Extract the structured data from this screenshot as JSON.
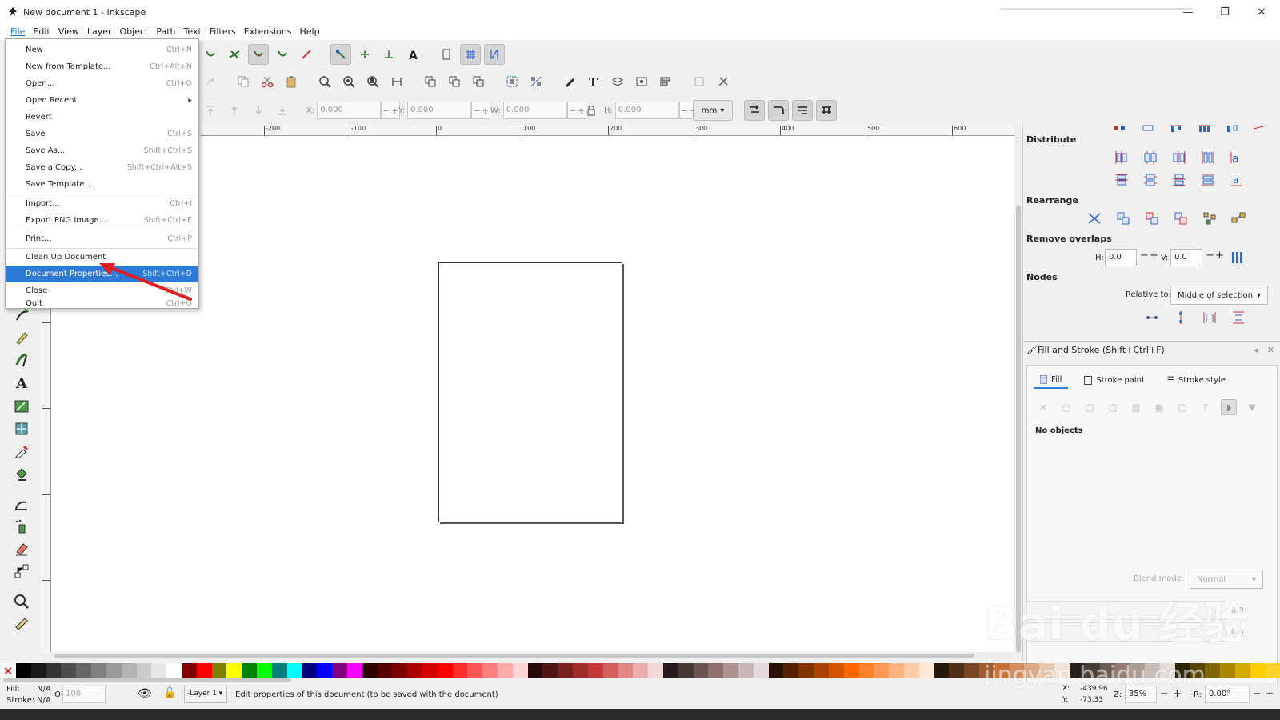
{
  "window": {
    "title": "New document 1 - Inkscape",
    "minimize": "—",
    "maximize": "❐",
    "close": "✕"
  },
  "menubar": [
    "File",
    "Edit",
    "View",
    "Layer",
    "Object",
    "Path",
    "Text",
    "Filters",
    "Extensions",
    "Help"
  ],
  "file_menu": [
    {
      "label": "New",
      "shortcut": "Ctrl+N"
    },
    {
      "label": "New from Template...",
      "shortcut": "Ctrl+Alt+N"
    },
    {
      "label": "Open...",
      "shortcut": "Ctrl+O"
    },
    {
      "label": "Open Recent",
      "shortcut": "▸"
    },
    {
      "label": "Revert",
      "shortcut": ""
    },
    {
      "label": "Save",
      "shortcut": "Ctrl+S"
    },
    {
      "label": "Save As...",
      "shortcut": "Shift+Ctrl+S"
    },
    {
      "label": "Save a Copy...",
      "shortcut": "Shift+Ctrl+Alt+S"
    },
    {
      "label": "Save Template...",
      "shortcut": ""
    },
    {
      "label": "Import...",
      "shortcut": "Ctrl+I"
    },
    {
      "label": "Export PNG Image...",
      "shortcut": "Shift+Ctrl+E"
    },
    {
      "label": "Print...",
      "shortcut": "Ctrl+P"
    },
    {
      "label": "Clean Up Document",
      "shortcut": ""
    },
    {
      "label": "Document Properties...",
      "shortcut": "Shift+Ctrl+D"
    },
    {
      "label": "Close",
      "shortcut": "Ctrl+W"
    },
    {
      "label": "Quit",
      "shortcut": "Ctrl+Q"
    }
  ],
  "toolcontrols": {
    "x_label": "X:",
    "x_value": "0.000",
    "y_label": "Y:",
    "y_value": "0.000",
    "w_label": "W:",
    "w_value": "0.000",
    "h_label": "H:",
    "h_value": "0.000",
    "units": "mm",
    "minus": "−",
    "plus": "+"
  },
  "ruler_labels": [
    "-200",
    "-100",
    "0",
    "100",
    "200",
    "300",
    "400",
    "500",
    "600"
  ],
  "right_panel": {
    "distribute": "Distribute",
    "rearrange": "Rearrange",
    "remove_overlaps": "Remove overlaps",
    "h_label": "H:",
    "h_value": "0.0",
    "v_label": "V:",
    "v_value": "0.0",
    "nodes": "Nodes",
    "relative_to_label": "Relative to:",
    "relative_to_value": "Middle of selection",
    "fill_stroke_title": "Fill and Stroke (Shift+Ctrl+F)",
    "tab_fill": "Fill",
    "tab_stroke_paint": "Stroke paint",
    "tab_stroke_style": "Stroke style",
    "no_objects": "No objects",
    "blend_mode_label": "Blend mode:",
    "blend_mode_value": "Normal",
    "blur_value": "0.0",
    "opacity_value": "0.0"
  },
  "status": {
    "fill_label": "Fill:",
    "fill_value": "N/A",
    "stroke_label": "Stroke:",
    "stroke_value": "N/A",
    "opacity_label": "O:",
    "opacity_value": "100",
    "layer": "-Layer 1",
    "message": "Edit properties of this document (to be saved with the document)",
    "x_label": "X:",
    "x_value": "-439.96",
    "y_label": "Y:",
    "y_value": "-73.33",
    "zoom_label": "Z:",
    "zoom_value": "35%",
    "rotation_label": "R:",
    "rotation_value": "0.00°"
  },
  "watermark": {
    "line1": "Bai du 经验",
    "line2": "jingyan.baidu.com"
  },
  "palette_colors": [
    "#000000",
    "#1a1a1a",
    "#333333",
    "#4d4d4d",
    "#666666",
    "#808080",
    "#999999",
    "#b3b3b3",
    "#cccccc",
    "#e6e6e6",
    "#ffffff",
    "#800000",
    "#ff0000",
    "#808000",
    "#ffff00",
    "#008000",
    "#00ff00",
    "#008080",
    "#00ffff",
    "#000080",
    "#0000ff",
    "#800080",
    "#ff00ff",
    "#2b0000",
    "#550000",
    "#800000",
    "#aa0000",
    "#d40000",
    "#ff0000",
    "#ff2a2a",
    "#ff5555",
    "#ff8080",
    "#ffaaaa",
    "#ffd5d5",
    "#280b0b",
    "#501616",
    "#782121",
    "#a02c2c",
    "#c83737",
    "#d35f5f",
    "#de8787",
    "#e9afaf",
    "#f4d7d7",
    "#241c1c",
    "#483737",
    "#6c5353",
    "#916f6f",
    "#ac9393",
    "#c8b7b7",
    "#e3dbdb",
    "#2b1100",
    "#552200",
    "#803300",
    "#aa4400",
    "#d45500",
    "#ff6600",
    "#ff7f2a",
    "#ff9955",
    "#ffb380",
    "#ffccaa",
    "#ffe6d5",
    "#28170b",
    "#502d16",
    "#784421",
    "#a05a2c",
    "#c87137",
    "#d38d5f",
    "#deaa87",
    "#e9c6af",
    "#f4e3d7",
    "#241f1c",
    "#483e37",
    "#6c5d53",
    "#917c6f",
    "#ac9d93",
    "#c8beb7",
    "#e3dedb",
    "#2b2200",
    "#554400",
    "#806600",
    "#aa8800",
    "#d4aa00",
    "#ffcc00",
    "#ffd42a"
  ]
}
